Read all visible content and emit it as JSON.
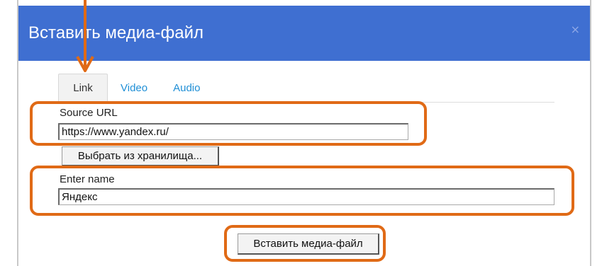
{
  "dialog": {
    "title": "Вставить медиа-файл",
    "close_glyph": "×",
    "header_color": "#3f6fd1"
  },
  "tabs": [
    {
      "label": "Link",
      "active": true
    },
    {
      "label": "Video",
      "active": false
    },
    {
      "label": "Audio",
      "active": false
    }
  ],
  "form": {
    "source_label": "Source URL",
    "source_value": "https://www.yandex.ru/",
    "browse_button": "Выбрать из хранилища...",
    "name_label": "Enter name",
    "name_value": "Яндекс",
    "insert_button": "Вставить медиа-файл"
  },
  "annotation": {
    "highlight_color": "#e06a16"
  }
}
